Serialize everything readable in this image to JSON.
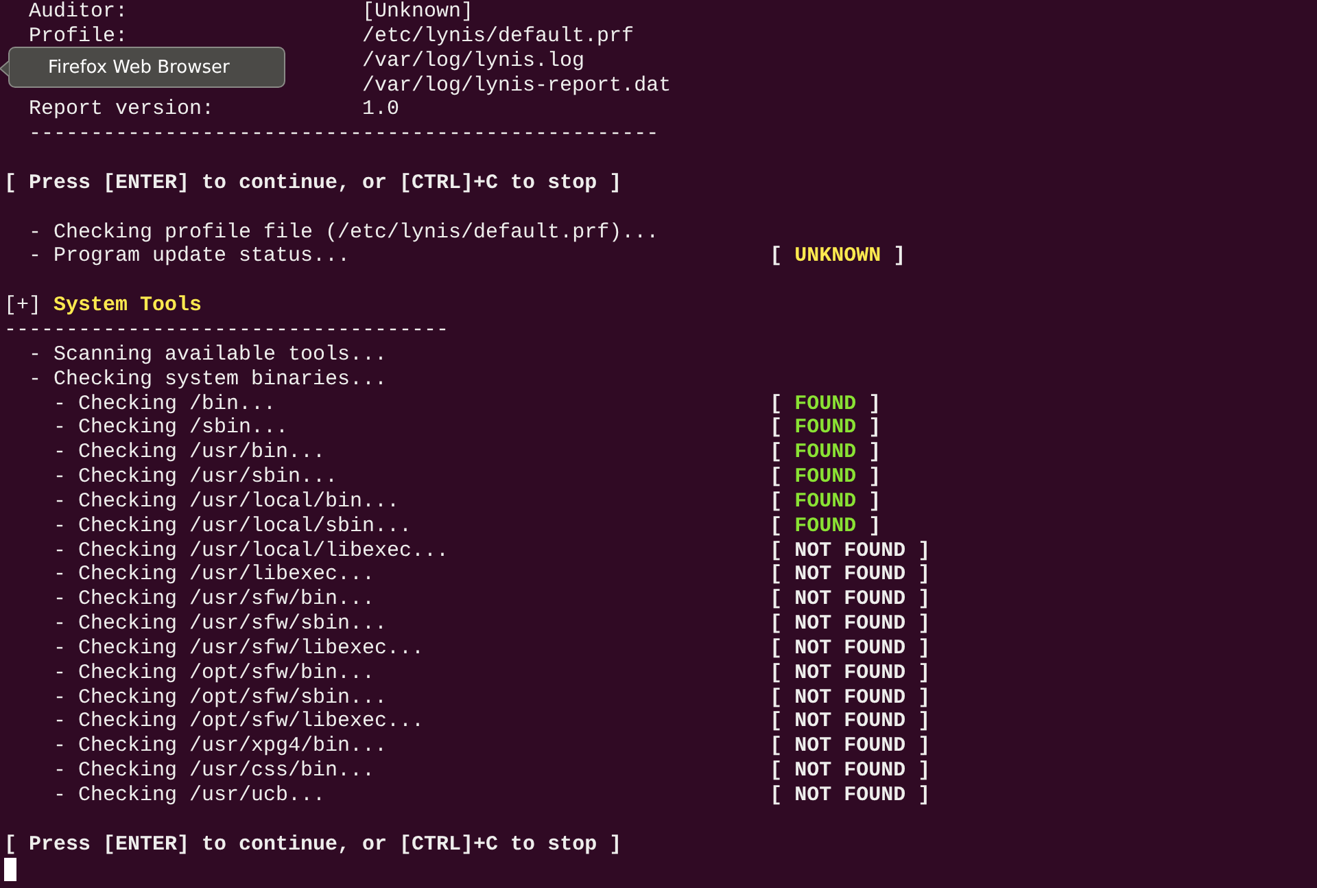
{
  "tooltip": {
    "text": "Firefox Web Browser"
  },
  "lines": [
    {
      "kind": "field",
      "label": "Auditor:",
      "value": "[Unknown]"
    },
    {
      "kind": "field",
      "label": "Profile:",
      "value": "/etc/lynis/default.prf"
    },
    {
      "kind": "field",
      "value": "/var/log/lynis.log"
    },
    {
      "kind": "field",
      "value": "/var/log/lynis-report.dat"
    },
    {
      "kind": "field",
      "label": "Report version:",
      "value": "1.0"
    },
    {
      "kind": "rule",
      "indented": true,
      "text": "---------------------------------------------------"
    },
    {
      "kind": "blank"
    },
    {
      "kind": "prompt",
      "text": "[ Press [ENTER] to continue, or [CTRL]+C to stop ]"
    },
    {
      "kind": "blank"
    },
    {
      "kind": "item",
      "text": "- Checking profile file (/etc/lynis/default.prf)..."
    },
    {
      "kind": "item",
      "text": "- Program update status...",
      "status": {
        "open": "[",
        "label": "UNKNOWN",
        "close": "]",
        "kind": "unknown"
      }
    },
    {
      "kind": "blank"
    },
    {
      "kind": "section",
      "marker": "[+]",
      "title": "System Tools"
    },
    {
      "kind": "rule",
      "indented": false,
      "text": "------------------------------------"
    },
    {
      "kind": "item",
      "text": "- Scanning available tools..."
    },
    {
      "kind": "item",
      "text": "- Checking system binaries..."
    },
    {
      "kind": "subitem",
      "text": "- Checking /bin...",
      "status": {
        "open": "[",
        "label": "FOUND",
        "close": "]",
        "kind": "found"
      }
    },
    {
      "kind": "subitem",
      "text": "- Checking /sbin...",
      "status": {
        "open": "[",
        "label": "FOUND",
        "close": "]",
        "kind": "found"
      }
    },
    {
      "kind": "subitem",
      "text": "- Checking /usr/bin...",
      "status": {
        "open": "[",
        "label": "FOUND",
        "close": "]",
        "kind": "found"
      }
    },
    {
      "kind": "subitem",
      "text": "- Checking /usr/sbin...",
      "status": {
        "open": "[",
        "label": "FOUND",
        "close": "]",
        "kind": "found"
      }
    },
    {
      "kind": "subitem",
      "text": "- Checking /usr/local/bin...",
      "status": {
        "open": "[",
        "label": "FOUND",
        "close": "]",
        "kind": "found"
      }
    },
    {
      "kind": "subitem",
      "text": "- Checking /usr/local/sbin...",
      "status": {
        "open": "[",
        "label": "FOUND",
        "close": "]",
        "kind": "found"
      }
    },
    {
      "kind": "subitem",
      "text": "- Checking /usr/local/libexec...",
      "status": {
        "open": "[",
        "label": "NOT FOUND",
        "close": "]",
        "kind": "missing"
      }
    },
    {
      "kind": "subitem",
      "text": "- Checking /usr/libexec...",
      "status": {
        "open": "[",
        "label": "NOT FOUND",
        "close": "]",
        "kind": "missing"
      }
    },
    {
      "kind": "subitem",
      "text": "- Checking /usr/sfw/bin...",
      "status": {
        "open": "[",
        "label": "NOT FOUND",
        "close": "]",
        "kind": "missing"
      }
    },
    {
      "kind": "subitem",
      "text": "- Checking /usr/sfw/sbin...",
      "status": {
        "open": "[",
        "label": "NOT FOUND",
        "close": "]",
        "kind": "missing"
      }
    },
    {
      "kind": "subitem",
      "text": "- Checking /usr/sfw/libexec...",
      "status": {
        "open": "[",
        "label": "NOT FOUND",
        "close": "]",
        "kind": "missing"
      }
    },
    {
      "kind": "subitem",
      "text": "- Checking /opt/sfw/bin...",
      "status": {
        "open": "[",
        "label": "NOT FOUND",
        "close": "]",
        "kind": "missing"
      }
    },
    {
      "kind": "subitem",
      "text": "- Checking /opt/sfw/sbin...",
      "status": {
        "open": "[",
        "label": "NOT FOUND",
        "close": "]",
        "kind": "missing"
      }
    },
    {
      "kind": "subitem",
      "text": "- Checking /opt/sfw/libexec...",
      "status": {
        "open": "[",
        "label": "NOT FOUND",
        "close": "]",
        "kind": "missing"
      }
    },
    {
      "kind": "subitem",
      "text": "- Checking /usr/xpg4/bin...",
      "status": {
        "open": "[",
        "label": "NOT FOUND",
        "close": "]",
        "kind": "missing"
      }
    },
    {
      "kind": "subitem",
      "text": "- Checking /usr/css/bin...",
      "status": {
        "open": "[",
        "label": "NOT FOUND",
        "close": "]",
        "kind": "missing"
      }
    },
    {
      "kind": "subitem",
      "text": "- Checking /usr/ucb...",
      "status": {
        "open": "[",
        "label": "NOT FOUND",
        "close": "]",
        "kind": "missing"
      }
    },
    {
      "kind": "blank"
    },
    {
      "kind": "prompt",
      "text": "[ Press [ENTER] to continue, or [CTRL]+C to stop ]"
    },
    {
      "kind": "cursor"
    }
  ]
}
